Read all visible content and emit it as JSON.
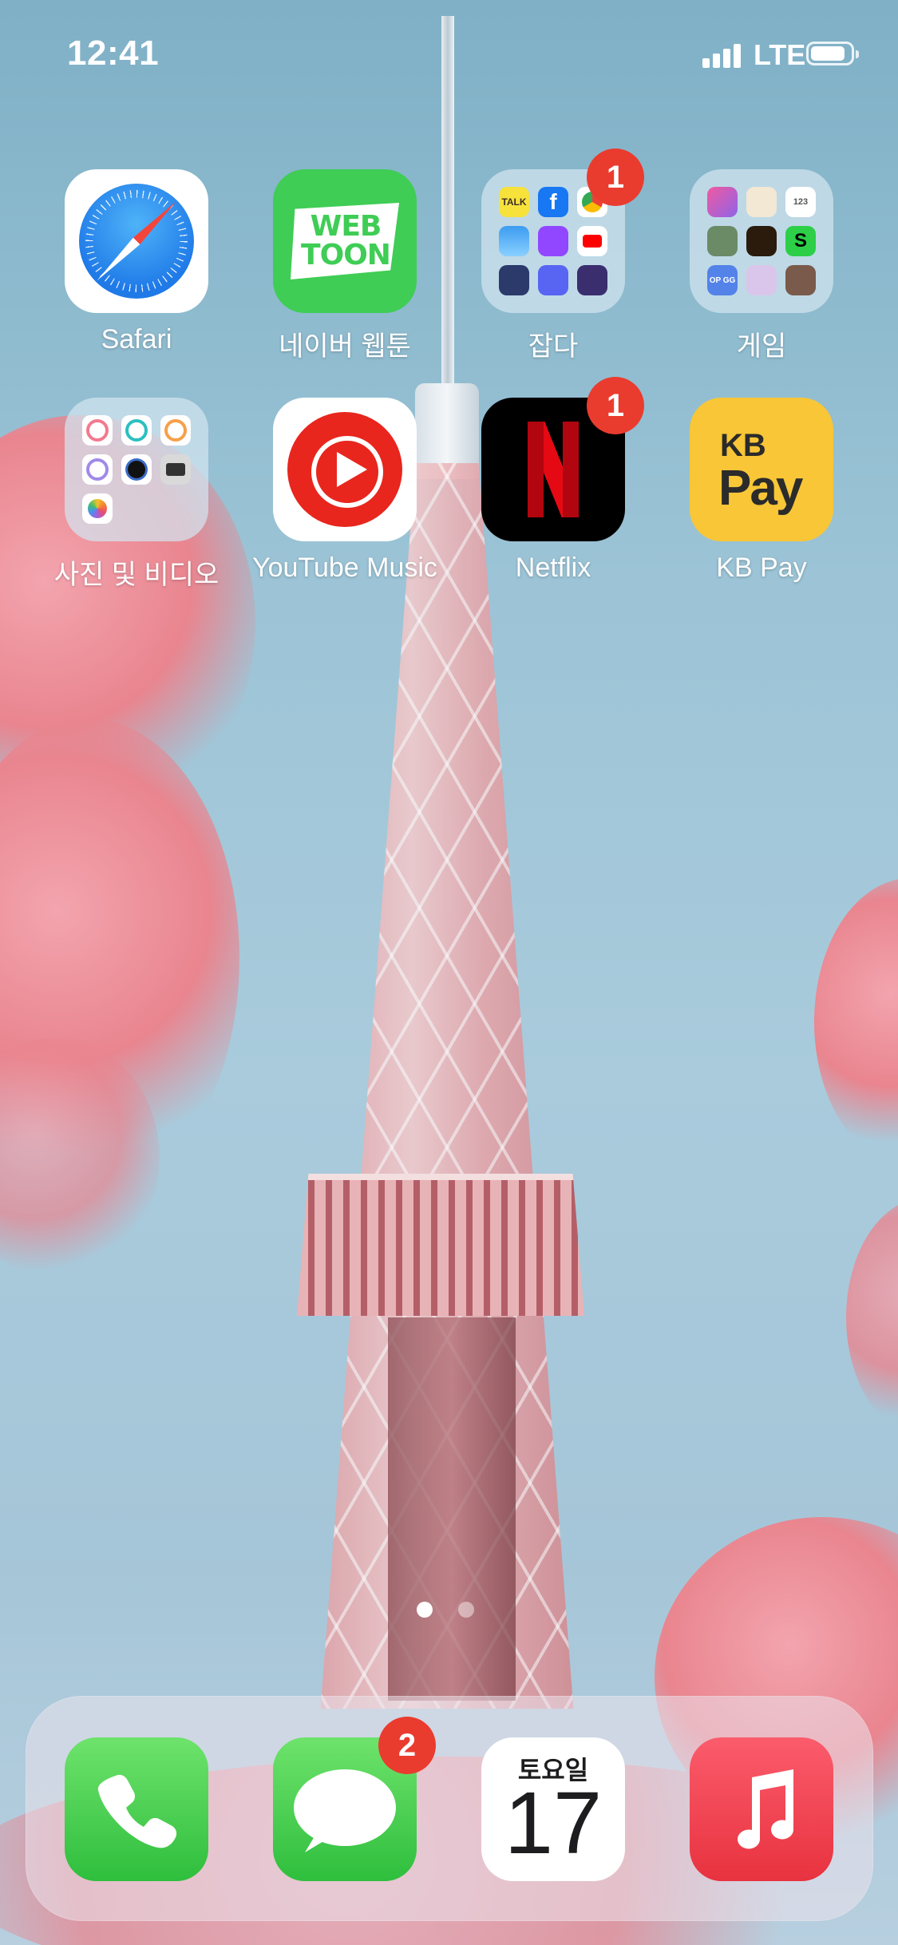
{
  "status_bar": {
    "time": "12:41",
    "network": "LTE"
  },
  "home_screen": {
    "apps": [
      {
        "label": "Safari"
      },
      {
        "label": "네이버 웹툰",
        "icon_text": "WEB TOON"
      },
      {
        "label": "잡다",
        "badge": "1",
        "folder_icons": [
          "TALK",
          "f",
          "chrome",
          "weather",
          "twitch",
          "youtube",
          "toss",
          "discord",
          "feather"
        ]
      },
      {
        "label": "게임",
        "folder_icons": [
          "blocks",
          "cat",
          "123",
          "castle",
          "circle",
          "S",
          "OP GG",
          "anime",
          "portrait"
        ]
      },
      {
        "label": "사진 및 비디오",
        "folder_icons": [
          "ring-pink",
          "ring-teal",
          "ring-orange",
          "ring-purple",
          "camera-lens",
          "camera",
          "photos"
        ]
      },
      {
        "label": "YouTube Music"
      },
      {
        "label": "Netflix",
        "badge": "1"
      },
      {
        "label": "KB Pay",
        "icon_text_top": "KB",
        "icon_text_bottom": "Pay"
      }
    ],
    "page_indicator": {
      "pages": 2,
      "current": 1
    }
  },
  "dock": {
    "apps": [
      {
        "name": "phone"
      },
      {
        "name": "messages",
        "badge": "2"
      },
      {
        "name": "calendar",
        "day": "토요일",
        "date": "17"
      },
      {
        "name": "music"
      }
    ]
  },
  "colors": {
    "badge": "#ea3b2f",
    "webtoon_green": "#3fcd55",
    "netflix_red": "#e50914",
    "kb_yellow": "#f8c636",
    "music_red": "#fb5c6c"
  }
}
